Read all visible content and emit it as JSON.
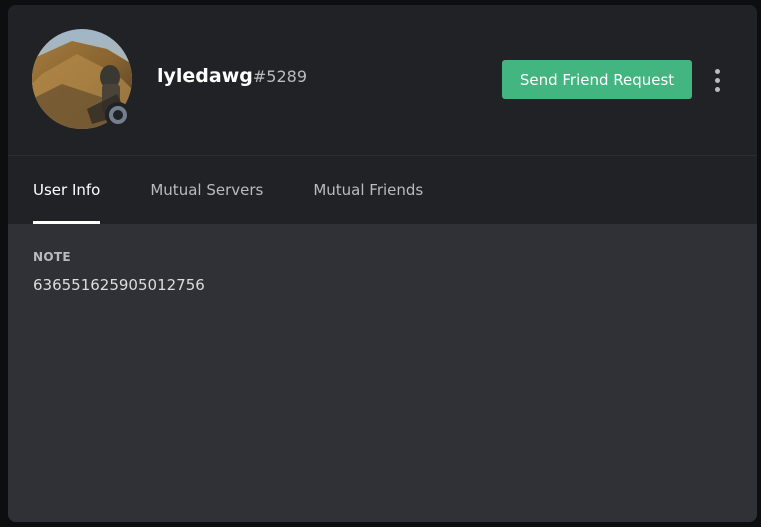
{
  "profile": {
    "username": "lyledawg",
    "discriminator": "#5289",
    "status": "offline",
    "send_friend_request_label": "Send Friend Request"
  },
  "tabs": [
    {
      "label": "User Info",
      "active": true
    },
    {
      "label": "Mutual Servers",
      "active": false
    },
    {
      "label": "Mutual Friends",
      "active": false
    }
  ],
  "user_info": {
    "note_label": "NOTE",
    "note_value": "636551625905012756"
  },
  "colors": {
    "modal_bg": "#2f3136",
    "header_bg": "#202225",
    "accent_green": "#43b581",
    "status_offline": "#747f8d",
    "text_primary": "#ffffff",
    "text_muted": "#b9bbbe"
  },
  "icons": {
    "more_options": "more-vertical-icon",
    "status": "status-offline-icon"
  }
}
